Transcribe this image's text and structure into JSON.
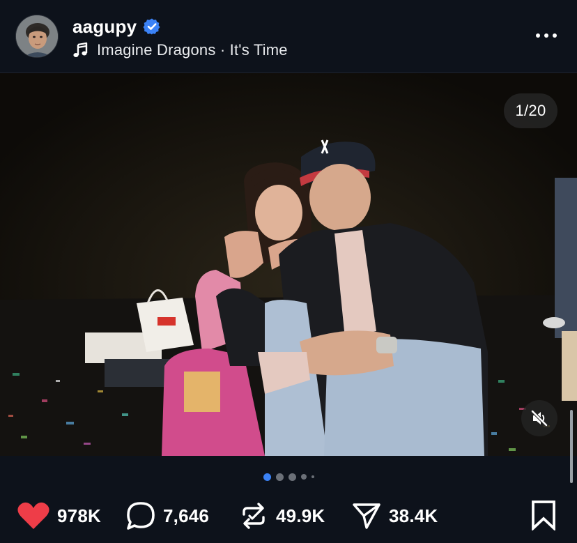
{
  "post": {
    "username": "aagupy",
    "verified": true,
    "music": "Imagine Dragons · It's Time",
    "more_icon": "ellipsis-icon"
  },
  "media": {
    "counter": "1/20",
    "muted": true,
    "current_slide": 1,
    "visible_dots": 5
  },
  "actions": {
    "likes": "978K",
    "comments": "7,646",
    "reposts": "49.9K",
    "shares": "38.4K"
  },
  "colors": {
    "background": "#0d121b",
    "like": "#ee3d48",
    "verified": "#3b82f6",
    "active_dot": "#3b82f6"
  }
}
